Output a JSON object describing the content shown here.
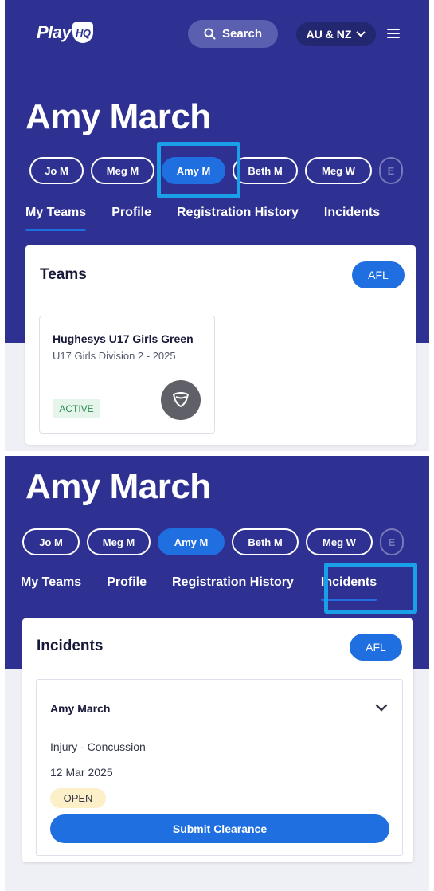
{
  "header": {
    "logo_text": "Play",
    "logo_badge": "HQ",
    "search_label": "Search",
    "region_label": "AU & NZ"
  },
  "profile": {
    "name": "Amy March"
  },
  "chips": [
    "Jo M",
    "Meg M",
    "Amy M",
    "Beth M",
    "Meg W",
    "E"
  ],
  "tabs": [
    "My Teams",
    "Profile",
    "Registration History",
    "Incidents"
  ],
  "teams_card": {
    "title": "Teams",
    "sport": "AFL",
    "team": {
      "name": "Hughesys U17 Girls Green",
      "division": "U17 Girls Division 2 - 2025",
      "status": "ACTIVE"
    }
  },
  "incidents_card": {
    "title": "Incidents",
    "sport": "AFL",
    "incident": {
      "person": "Amy March",
      "type": "Injury - Concussion",
      "date": "12 Mar 2025",
      "status": "OPEN",
      "action_label": "Submit Clearance"
    }
  },
  "colors": {
    "brand": "#2e3192",
    "accent": "#1f6fe0",
    "highlight": "#1aa0e8",
    "status_active": "#2b8a4e",
    "status_open_bg": "#fdf0c8"
  }
}
